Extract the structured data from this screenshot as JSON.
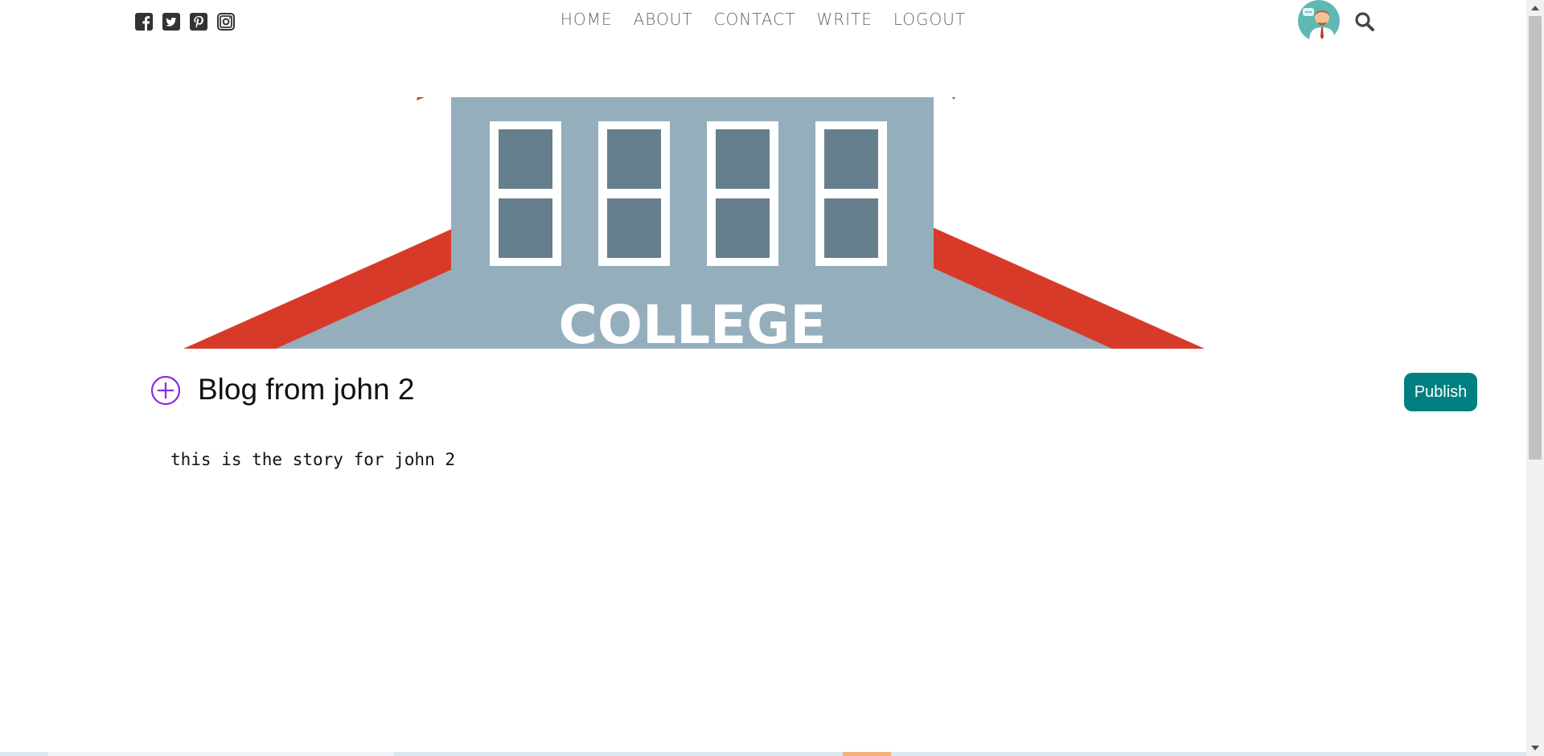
{
  "nav": {
    "social_icons": [
      "facebook-square-icon",
      "twitter-square-icon",
      "pinterest-square-icon",
      "instagram-icon"
    ],
    "menu": [
      {
        "label": "HOME"
      },
      {
        "label": "ABOUT"
      },
      {
        "label": "CONTACT"
      },
      {
        "label": "WRITE"
      },
      {
        "label": "LOGOUT"
      }
    ],
    "avatar_icon": "user-avatar",
    "search_icon": "search-icon"
  },
  "cover": {
    "text": "COLLEGE",
    "colors": {
      "roof": "#d83a2a",
      "building": "#94aebc",
      "window": "#667f8c",
      "frame": "#ffffff"
    }
  },
  "write": {
    "add_icon": "plus-circle-icon",
    "title_value": "Blog from john 2",
    "story_value": "this is the story for john 2",
    "publish_label": "Publish"
  },
  "colors": {
    "accent": "#008080",
    "add_icon": "#8a2be2",
    "nav_text": "#666666"
  }
}
